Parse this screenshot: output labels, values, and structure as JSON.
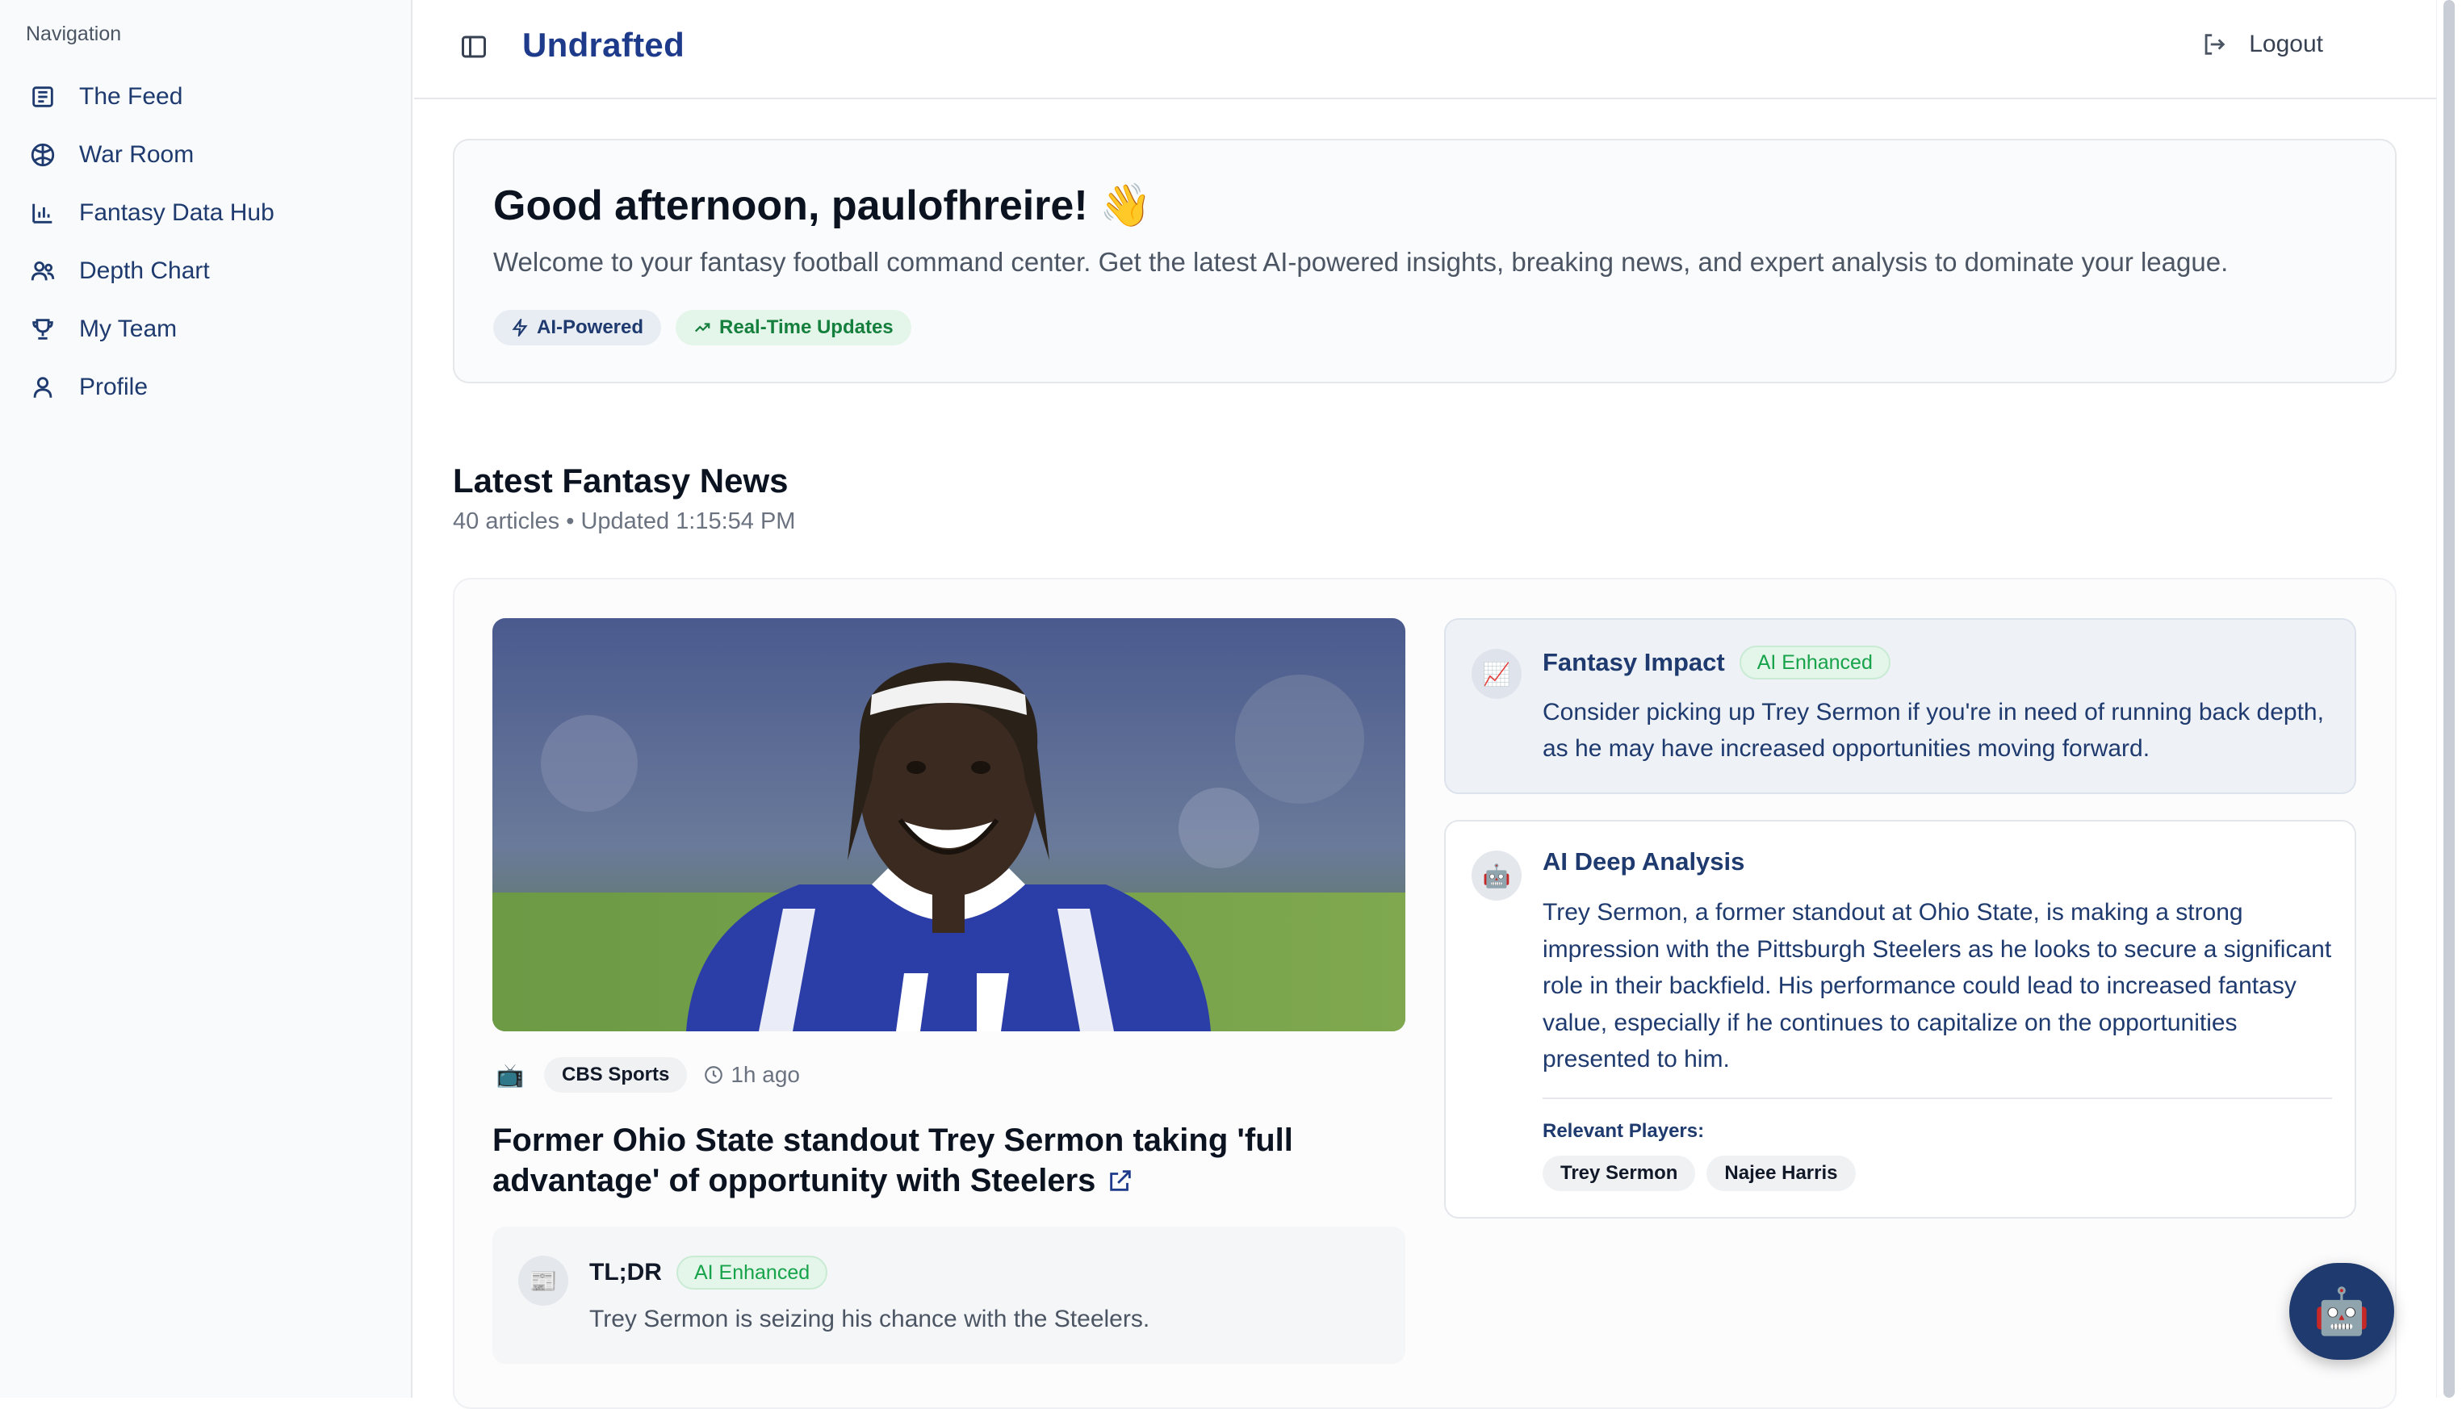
{
  "sidebar": {
    "heading": "Navigation",
    "items": [
      {
        "label": "The Feed",
        "icon": "newspaper-icon"
      },
      {
        "label": "War Room",
        "icon": "football-icon"
      },
      {
        "label": "Fantasy Data Hub",
        "icon": "bar-chart-icon"
      },
      {
        "label": "Depth Chart",
        "icon": "users-icon"
      },
      {
        "label": "My Team",
        "icon": "trophy-icon"
      },
      {
        "label": "Profile",
        "icon": "user-icon"
      }
    ]
  },
  "header": {
    "brand": "Undrafted",
    "logout_label": "Logout"
  },
  "welcome": {
    "greeting": "Good afternoon, paulofhreire! 👋",
    "subtitle": "Welcome to your fantasy football command center. Get the latest AI-powered insights, breaking news, and expert analysis to dominate your league.",
    "badges": [
      "AI-Powered",
      "Real-Time Updates"
    ]
  },
  "news": {
    "title": "Latest Fantasy News",
    "meta": "40 articles • Updated 1:15:54 PM"
  },
  "article": {
    "source_icon": "📺",
    "source": "CBS Sports",
    "time_ago": "1h ago",
    "headline": "Former Ohio State standout Trey Sermon taking 'full advantage' of opportunity with Steelers",
    "tldr": {
      "icon": "📰",
      "title": "TL;DR",
      "badge": "AI Enhanced",
      "text": "Trey Sermon is seizing his chance with the Steelers."
    },
    "fantasy_impact": {
      "icon": "📈",
      "title": "Fantasy Impact",
      "badge": "AI Enhanced",
      "text": "Consider picking up Trey Sermon if you're in need of running back depth, as he may have increased opportunities moving forward."
    },
    "deep_analysis": {
      "icon": "🤖",
      "title": "AI Deep Analysis",
      "text": "Trey Sermon, a former standout at Ohio State, is making a strong impression with the Pittsburgh Steelers as he looks to secure a significant role in their backfield. His performance could lead to increased fantasy value, especially if he continues to capitalize on the opportunities presented to him.",
      "players_label": "Relevant Players:",
      "players": [
        "Trey Sermon",
        "Najee Harris"
      ]
    }
  },
  "assistant_button_icon": "🤖",
  "colors": {
    "brand": "#1e3a8a",
    "nav_text": "#1e3a6e",
    "ai_green": "#16a34a"
  }
}
